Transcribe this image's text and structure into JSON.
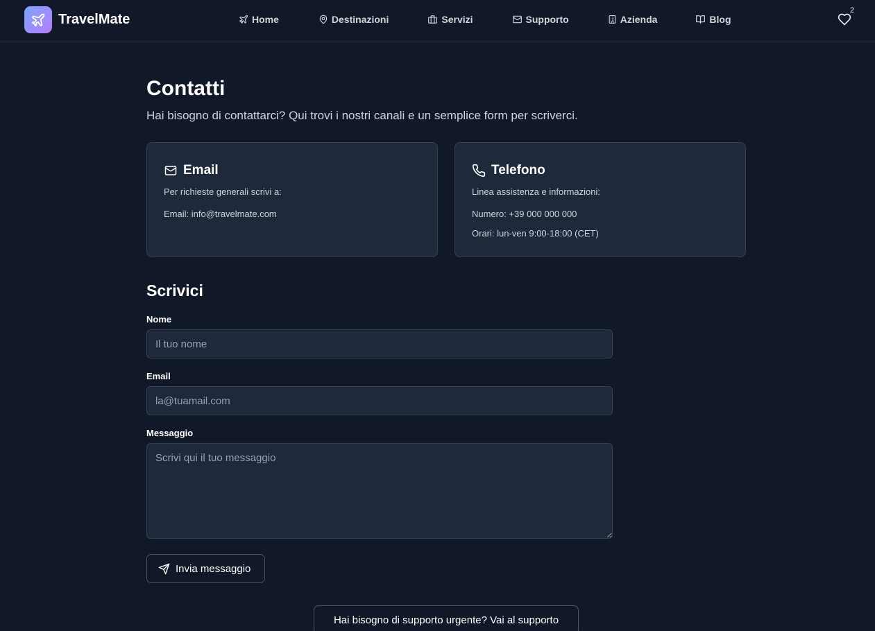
{
  "header": {
    "brand": "TravelMate",
    "favorites_count": "2",
    "nav": [
      {
        "label": "Home",
        "icon": "plane-icon"
      },
      {
        "label": "Destinazioni",
        "icon": "map-pin-icon"
      },
      {
        "label": "Servizi",
        "icon": "briefcase-icon"
      },
      {
        "label": "Supporto",
        "icon": "mail-icon"
      },
      {
        "label": "Azienda",
        "icon": "building-icon"
      },
      {
        "label": "Blog",
        "icon": "book-open-icon"
      }
    ]
  },
  "page": {
    "title": "Contatti",
    "subtitle": "Hai bisogno di contattarci? Qui trovi i nostri canali e un semplice form per scriverci."
  },
  "cards": {
    "email": {
      "title": "Email",
      "intro": "Per richieste generali scrivi a:",
      "value": "Email: info@travelmate.com"
    },
    "phone": {
      "title": "Telefono",
      "intro": "Linea assistenza e informazioni:",
      "number": "Numero: +39 000 000 000",
      "hours": "Orari: lun-ven 9:00-18:00 (CET)"
    }
  },
  "form": {
    "title": "Scrivici",
    "name_label": "Nome",
    "name_placeholder": "Il tuo nome",
    "email_label": "Email",
    "email_placeholder": "la@tuamail.com",
    "message_label": "Messaggio",
    "message_placeholder": "Scrivi qui il tuo messaggio",
    "submit_label": "Invia messaggio"
  },
  "support_button": "Hai bisogno di supporto urgente? Vai al supporto",
  "colors": {
    "background": "#111827",
    "card": "#1e293b",
    "border": "#334155",
    "logo_gradient_start": "#7aa6ff",
    "logo_gradient_end": "#b57cff"
  }
}
